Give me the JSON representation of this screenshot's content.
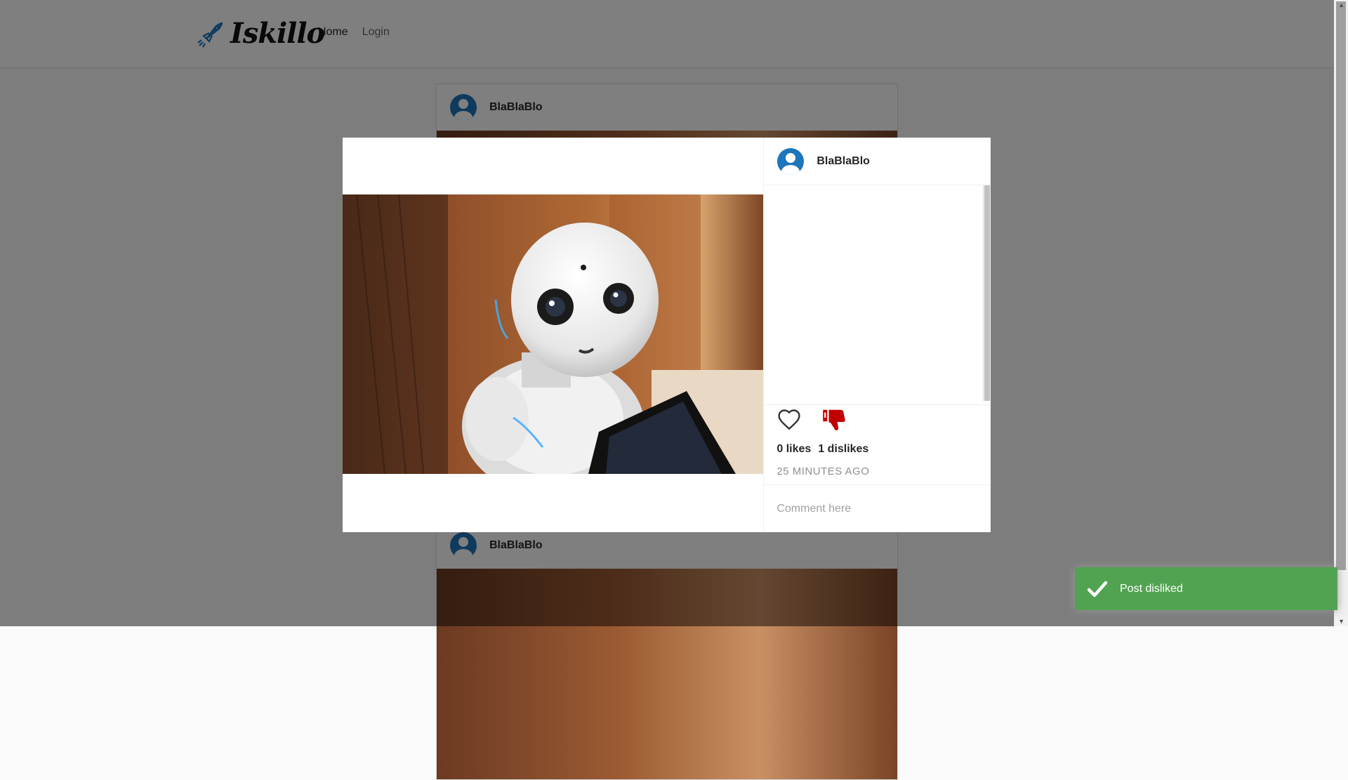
{
  "nav": {
    "logo_text": "Iskillo",
    "home_label": "Home",
    "login_label": "Login"
  },
  "feed": {
    "posts": [
      {
        "username": "BlaBlaBlo"
      },
      {
        "username": "BlaBlaBlo"
      }
    ]
  },
  "modal": {
    "username": "BlaBlaBlo",
    "likes_text": "0 likes",
    "dislikes_text": "1 dislikes",
    "time_text": "25 MINUTES AGO",
    "comment_placeholder": "Comment here",
    "like_icon": "heart-outline-icon",
    "dislike_icon": "thumbs-down-icon",
    "dislike_active_color": "#c00000"
  },
  "toast": {
    "message": "Post disliked",
    "color": "#51a351"
  }
}
